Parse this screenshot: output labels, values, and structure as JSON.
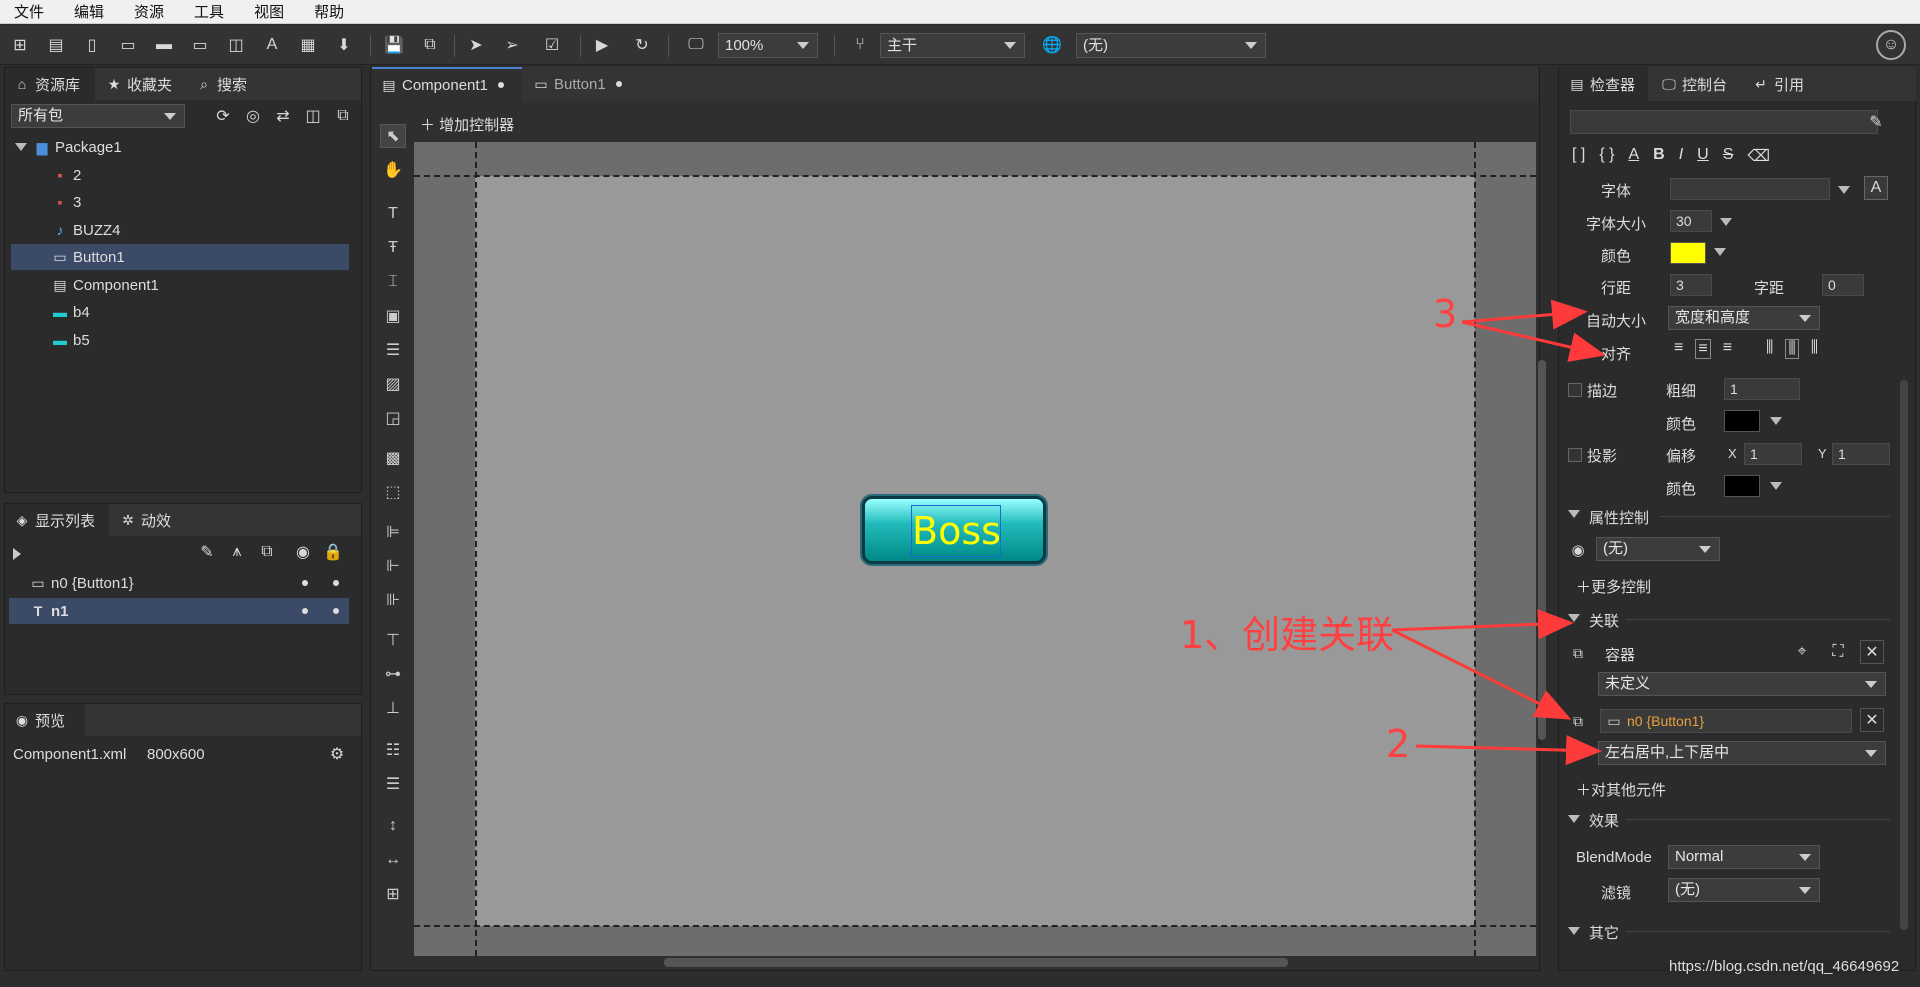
{
  "menu": [
    "文件",
    "编辑",
    "资源",
    "工具",
    "视图",
    "帮助"
  ],
  "toolbar": {
    "zoom": "100%",
    "branch": "主干",
    "language": "(无)"
  },
  "library": {
    "tabs": [
      "资源库",
      "收藏夹",
      "搜索"
    ],
    "filter": "所有包",
    "package": "Package1",
    "items": [
      "2",
      "3",
      "BUZZ4",
      "Button1",
      "Component1",
      "b4",
      "b5"
    ]
  },
  "displayList": {
    "tabs": [
      "显示列表",
      "动效"
    ],
    "rows": [
      "n0 {Button1}",
      "n1"
    ]
  },
  "preview": {
    "tab": "预览",
    "file": "Component1.xml",
    "size": "800x600"
  },
  "editor": {
    "tabs": [
      "Component1",
      "Button1"
    ],
    "addController": "增加控制器",
    "buttonText": "Boss"
  },
  "inspector": {
    "tabs": [
      "检查器",
      "控制台",
      "引用"
    ],
    "font_label": "字体",
    "fontsize_label": "字体大小",
    "fontsize": "30",
    "color_label": "颜色",
    "text_color": "#ffff00",
    "linespacing_label": "行距",
    "linespacing": "3",
    "letterspacing_label": "字距",
    "letterspacing": "0",
    "autosize_label": "自动大小",
    "autosize": "宽度和高度",
    "align_label": "对齐",
    "stroke_label": "描边",
    "stroke_width_label": "粗细",
    "stroke_width": "1",
    "stroke_color_label": "颜色",
    "shadow_label": "投影",
    "offset_label": "偏移",
    "offset_x_label": "X",
    "offset_x": "1",
    "offset_y_label": "Y",
    "offset_y": "1",
    "shadow_color_label": "颜色",
    "prop_ctrl_section": "属性控制",
    "prop_ctrl_value": "(无)",
    "more_ctrl": "更多控制",
    "relation_section": "关联",
    "container_label": "容器",
    "container_value": "未定义",
    "relation_target": "n0 {Button1}",
    "relation_value": "左右居中,上下居中",
    "other_element": "对其他元件",
    "effect_section": "效果",
    "blendmode_label": "BlendMode",
    "blendmode": "Normal",
    "filter_label": "滤镜",
    "filter": "(无)",
    "other_section": "其它"
  },
  "annotations": {
    "a3": "3",
    "a1": "1、创建关联",
    "a2": "2"
  },
  "watermark": "https://blog.csdn.net/qq_46649692"
}
